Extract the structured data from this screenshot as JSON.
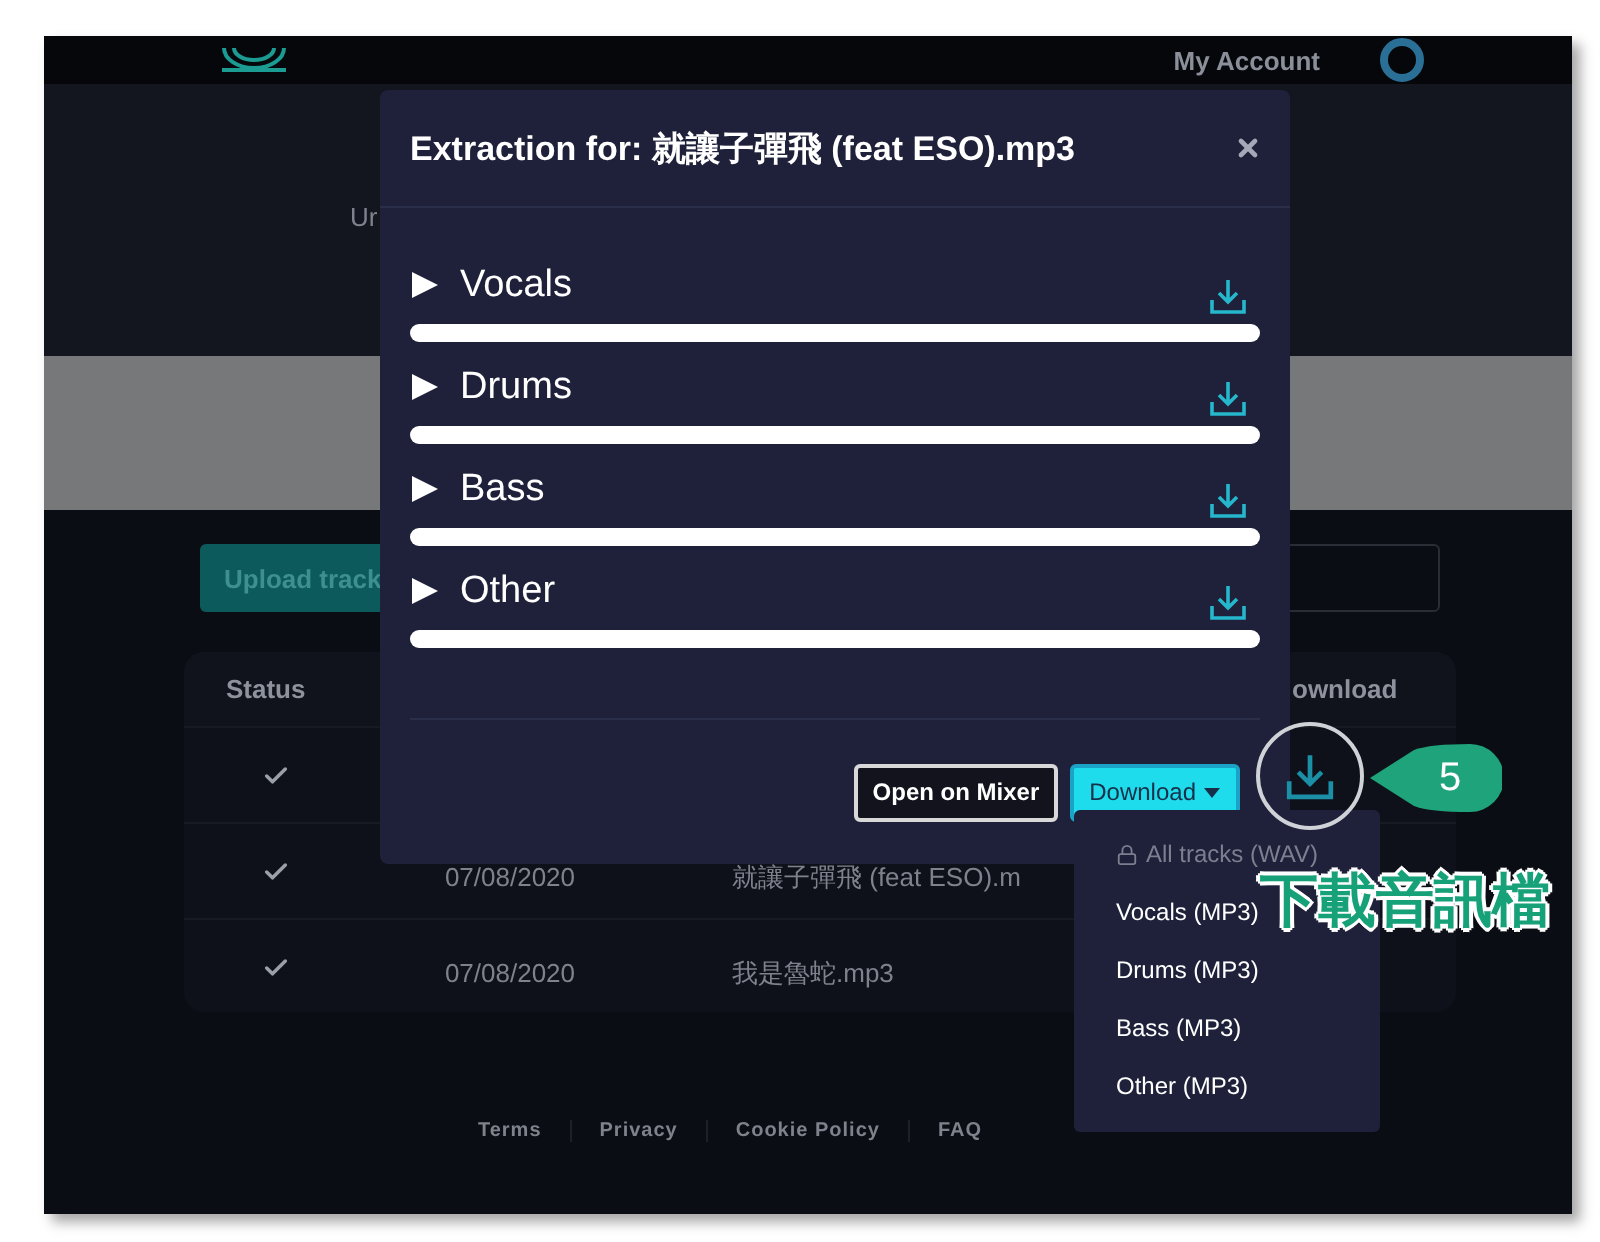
{
  "nav": {
    "account": "My Account"
  },
  "banner_text": "Ur",
  "upload_button": "Upload track",
  "table": {
    "columns": [
      "Status",
      "ownload"
    ],
    "rows": [
      {
        "done": true
      },
      {
        "done": true,
        "date": "07/08/2020",
        "file": "就讓子彈飛 (feat ESO).m"
      },
      {
        "done": true,
        "date": "07/08/2020",
        "file": "我是魯蛇.mp3"
      }
    ]
  },
  "footer_links": [
    "Terms",
    "Privacy",
    "Cookie Policy",
    "FAQ"
  ],
  "modal": {
    "title_label": "Extraction for:",
    "title_file": "就讓子彈飛 (feat ESO).mp3",
    "stems": [
      {
        "name": "Vocals"
      },
      {
        "name": "Drums"
      },
      {
        "name": "Bass"
      },
      {
        "name": "Other"
      }
    ],
    "mixer_button": "Open on Mixer",
    "download_button": "Download",
    "download_menu": [
      {
        "label": "All tracks (WAV)",
        "disabled": true
      },
      {
        "label": "Vocals (MP3)",
        "disabled": false
      },
      {
        "label": "Drums (MP3)",
        "disabled": false
      },
      {
        "label": "Bass (MP3)",
        "disabled": false
      },
      {
        "label": "Other (MP3)",
        "disabled": false
      }
    ]
  },
  "annotation": {
    "step": "5",
    "caption": "下載音訊檔"
  }
}
